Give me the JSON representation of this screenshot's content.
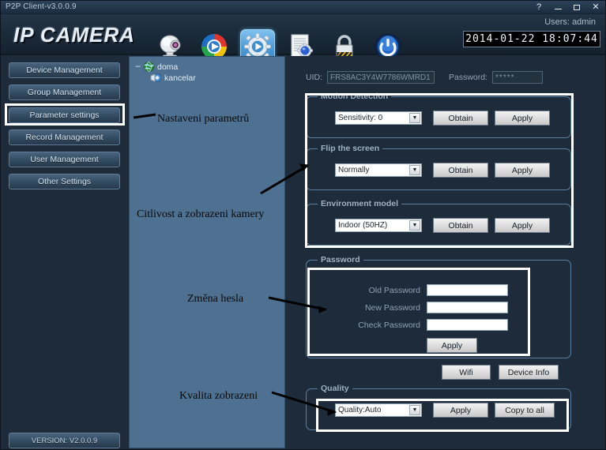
{
  "window": {
    "title": "P2P Client-v3.0.0.9",
    "controls": {
      "help": "?",
      "minimize": "–",
      "maximize": "□",
      "close": "✕"
    }
  },
  "header": {
    "brand": "IP CAMERA",
    "users_label": "Users: admin",
    "datetime": "2014-01-22 18:07:44",
    "toolbar": [
      {
        "name": "camera-icon",
        "selected": false
      },
      {
        "name": "media-player-icon",
        "selected": false
      },
      {
        "name": "settings-gear-icon",
        "selected": true
      },
      {
        "name": "document-settings-icon",
        "selected": false
      },
      {
        "name": "lock-icon",
        "selected": false
      },
      {
        "name": "power-icon",
        "selected": false
      }
    ]
  },
  "sidebar": {
    "items": [
      {
        "label": "Device Management",
        "selected": false
      },
      {
        "label": "Group Management",
        "selected": false
      },
      {
        "label": "Parameter settings",
        "selected": true
      },
      {
        "label": "Record Management",
        "selected": false
      },
      {
        "label": "User Management",
        "selected": false
      },
      {
        "label": "Other Settings",
        "selected": false
      }
    ],
    "version": "VERSION: V2.0.0.9"
  },
  "tree": {
    "root": {
      "label": "doma",
      "expander": "–",
      "icon": "globe-icon"
    },
    "child": {
      "label": "kancelar",
      "icon": "camera-node-icon"
    }
  },
  "connection": {
    "uid_label": "UID:",
    "uid_value": "FRS8AC3Y4W7786WMRD1",
    "password_label": "Password:",
    "password_value": "*****"
  },
  "motion_detection": {
    "title": "Motion Detection",
    "select_value": "Sensitivity: 0",
    "obtain_label": "Obtain",
    "apply_label": "Apply"
  },
  "flip_screen": {
    "title": "Flip the screen",
    "select_value": "Normally",
    "obtain_label": "Obtain",
    "apply_label": "Apply"
  },
  "environment_model": {
    "title": "Environment model",
    "select_value": "Indoor (50HZ)",
    "obtain_label": "Obtain",
    "apply_label": "Apply"
  },
  "password_group": {
    "title": "Password",
    "old_label": "Old Password",
    "new_label": "New Password",
    "check_label": "Check Password",
    "old_value": "",
    "new_value": "",
    "check_value": "",
    "apply_label": "Apply"
  },
  "extra_buttons": {
    "wifi_label": "Wifi",
    "device_info_label": "Device Info"
  },
  "quality_group": {
    "title": "Quality",
    "select_value": "Quality:Auto",
    "apply_label": "Apply",
    "copy_all_label": "Copy to all"
  },
  "annotations": [
    {
      "text": "Nastaveni parametrů"
    },
    {
      "text": "Citlivost a zobrazeni kamery"
    },
    {
      "text": "Změna hesla"
    },
    {
      "text": "Kvalita zobrazeni"
    }
  ],
  "colors": {
    "app_background": "#1d2b3a",
    "tree_panel": "#4e7091",
    "accent_selected": "#4d9ad6",
    "highlight_box": "#ffffff",
    "group_border": "#5a7fa3"
  }
}
